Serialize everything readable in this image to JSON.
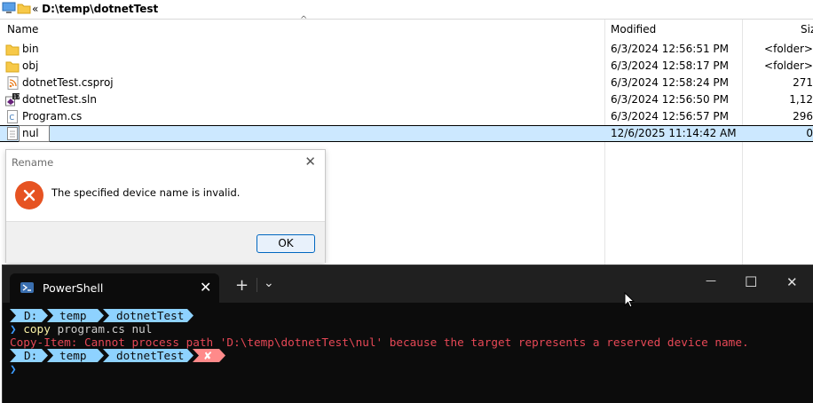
{
  "address": {
    "prefix": "«",
    "path": "D:\\temp\\dotnetTest"
  },
  "columns": {
    "name": "Name",
    "modified": "Modified",
    "size": "Siz"
  },
  "files": [
    {
      "name": "bin",
      "modified": "6/3/2024 12:56:51 PM",
      "size": "<folder>",
      "icon": "folder-icon"
    },
    {
      "name": "obj",
      "modified": "6/3/2024 12:58:17 PM",
      "size": "<folder>",
      "icon": "folder-icon"
    },
    {
      "name": "dotnetTest.csproj",
      "modified": "6/3/2024 12:58:24 PM",
      "size": "271",
      "icon": "rss-file-icon"
    },
    {
      "name": "dotnetTest.sln",
      "modified": "6/3/2024 12:56:50 PM",
      "size": "1,12",
      "icon": "visual-studio-icon"
    },
    {
      "name": "Program.cs",
      "modified": "6/3/2024 12:56:57 PM",
      "size": "296",
      "icon": "csharp-file-icon"
    },
    {
      "name": "nul",
      "modified": "12/6/2025 11:14:42 AM",
      "size": "0",
      "icon": "text-file-icon"
    }
  ],
  "dialog": {
    "title": "Rename",
    "message": "The specified device name is invalid.",
    "ok_label": "OK",
    "close": "✕"
  },
  "terminal": {
    "tab_title": "PowerShell",
    "tab_close": "✕",
    "new_tab": "+",
    "dropdown": "⌄",
    "minimize": "—",
    "maximize": "☐",
    "close": "✕",
    "prompt_segments": [
      "D:",
      "temp",
      "dotnetTest"
    ],
    "prompt_char": "❯",
    "command_keyword": "copy",
    "command_args": "program.cs nul",
    "error": "Copy-Item: Cannot process path 'D:\\temp\\dotnetTest\\nul' because the target represents a reserved device name.",
    "error_badge": "✘"
  },
  "colors": {
    "accent": "#8ed2ff",
    "error_text": "#e74856",
    "error_badge": "#ff8a8a",
    "keyword": "#f9f1a5",
    "prompt": "#3b9cff"
  }
}
